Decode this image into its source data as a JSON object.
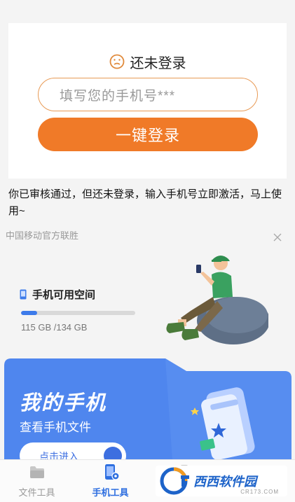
{
  "login": {
    "title": "还未登录",
    "phone_placeholder": "填写您的手机号***",
    "login_button": "一键登录"
  },
  "notice": "你已审核通过，但还未登录，输入手机号立即激活，马上使用~",
  "ad": {
    "tag": "中国移动官方联胜"
  },
  "storage": {
    "label": "手机可用空间",
    "used_fraction": 0.14,
    "text": "115 GB  /134 GB"
  },
  "banner": {
    "title": "我的手机",
    "subtitle": "查看手机文件",
    "button": "点击进入"
  },
  "tabs": [
    {
      "label": "文件工具",
      "icon": "folder-icon",
      "active": false
    },
    {
      "label": "手机工具",
      "icon": "phone-gear-icon",
      "active": true
    },
    {
      "label": "",
      "icon": "briefcase-icon",
      "active": false
    },
    {
      "label": "",
      "icon": "person-icon",
      "active": false
    }
  ],
  "watermark": {
    "brand": "西西软件园",
    "url": "CR173.COM"
  },
  "colors": {
    "accent_orange": "#f07a28",
    "accent_blue": "#3d7bea",
    "banner_blue": "#4f86ee"
  }
}
